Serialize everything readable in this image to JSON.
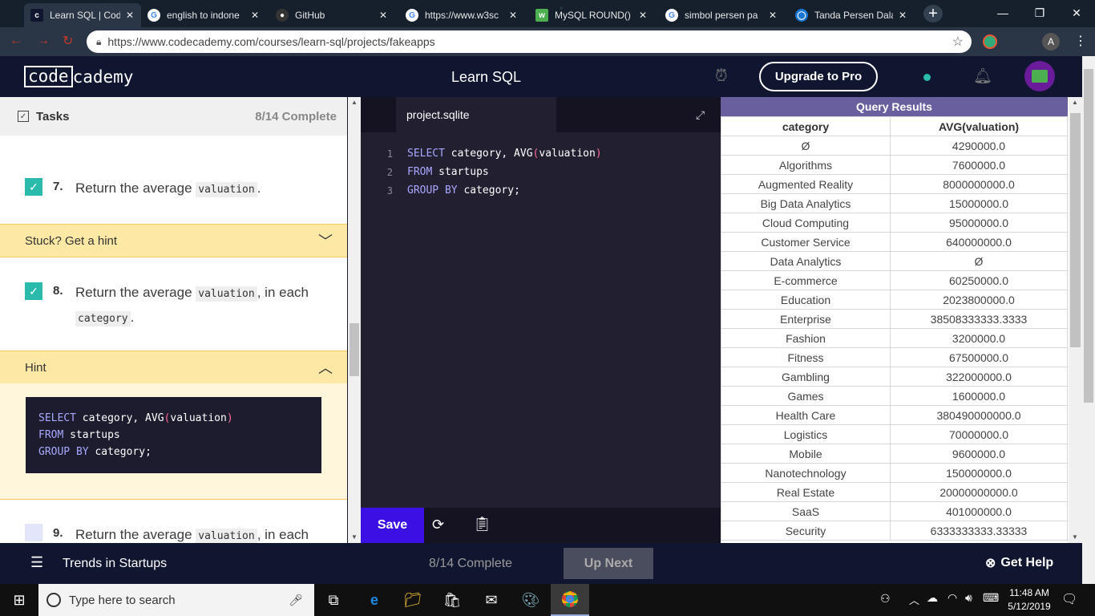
{
  "browser": {
    "tabs": [
      {
        "title": "Learn SQL | Code",
        "icon": "codecademy-favicon",
        "active": true
      },
      {
        "title": "english to indone",
        "icon": "google-favicon"
      },
      {
        "title": "GitHub",
        "icon": "github-favicon"
      },
      {
        "title": "https://www.w3sc",
        "icon": "google-favicon"
      },
      {
        "title": "MySQL ROUND()",
        "icon": "w3schools-favicon"
      },
      {
        "title": "simbol persen pa",
        "icon": "google-favicon"
      },
      {
        "title": "Tanda Persen Dala",
        "icon": "globe-favicon"
      }
    ],
    "new_tab": "+",
    "url": "https://www.codecademy.com/courses/learn-sql/projects/fakeapps",
    "profile_letter": "A"
  },
  "header": {
    "logo_left": "code",
    "logo_right": "cademy",
    "title": "Learn SQL",
    "upgrade_label": "Upgrade to Pro"
  },
  "tasks": {
    "label": "Tasks",
    "progress": "8/14 Complete",
    "items": [
      {
        "num": "7.",
        "text_before": "Return the average ",
        "code": "valuation",
        "text_after": ".",
        "checked": true
      },
      {
        "num": "8.",
        "text_before": "Return the average ",
        "code": "valuation",
        "text_middle": ", in each",
        "code2": "category",
        "text_after": ".",
        "checked": true
      },
      {
        "num": "9.",
        "text_before": "Return the average ",
        "code": "valuation",
        "text_after": ", in each",
        "checked": false
      }
    ],
    "hint_collapsed_label": "Stuck? Get a hint",
    "hint_open_label": "Hint",
    "hint_code": [
      "SELECT",
      " category, AVG",
      "(",
      "valuation",
      ")",
      "FROM",
      " startups",
      "GROUP BY",
      " category;"
    ]
  },
  "editor": {
    "filename": "project.sqlite",
    "lines": [
      {
        "n": "1",
        "kw": "SELECT",
        "rest": " category, AVG",
        "p1": "(",
        "arg": "valuation",
        "p2": ")"
      },
      {
        "n": "2",
        "kw": "FROM",
        "rest": " startups"
      },
      {
        "n": "3",
        "kw": "GROUP BY",
        "rest": " category;"
      }
    ],
    "save_label": "Save"
  },
  "results": {
    "title": "Query Results",
    "columns": [
      "category",
      "AVG(valuation)"
    ],
    "rows": [
      [
        "Ø",
        "4290000.0"
      ],
      [
        "Algorithms",
        "7600000.0"
      ],
      [
        "Augmented Reality",
        "8000000000.0"
      ],
      [
        "Big Data Analytics",
        "15000000.0"
      ],
      [
        "Cloud Computing",
        "95000000.0"
      ],
      [
        "Customer Service",
        "640000000.0"
      ],
      [
        "Data Analytics",
        "Ø"
      ],
      [
        "E-commerce",
        "60250000.0"
      ],
      [
        "Education",
        "2023800000.0"
      ],
      [
        "Enterprise",
        "38508333333.3333"
      ],
      [
        "Fashion",
        "3200000.0"
      ],
      [
        "Fitness",
        "67500000.0"
      ],
      [
        "Gambling",
        "322000000.0"
      ],
      [
        "Games",
        "1600000.0"
      ],
      [
        "Health Care",
        "380490000000.0"
      ],
      [
        "Logistics",
        "70000000.0"
      ],
      [
        "Mobile",
        "9600000.0"
      ],
      [
        "Nanotechnology",
        "150000000.0"
      ],
      [
        "Real Estate",
        "20000000000.0"
      ],
      [
        "SaaS",
        "401000000.0"
      ],
      [
        "Security",
        "6333333333.33333"
      ]
    ]
  },
  "bottom": {
    "project_title": "Trends in Startups",
    "progress": "8/14 Complete",
    "up_next": "Up Next",
    "get_help": "Get Help"
  },
  "taskbar": {
    "search_placeholder": "Type here to search",
    "time": "11:48 AM",
    "date": "5/12/2019"
  },
  "colors": {
    "accent": "#3a10e5",
    "check": "#2bbbad",
    "hint_bg": "#fde8a6",
    "header_bg": "#10162f",
    "editor_bg": "#211f30"
  }
}
